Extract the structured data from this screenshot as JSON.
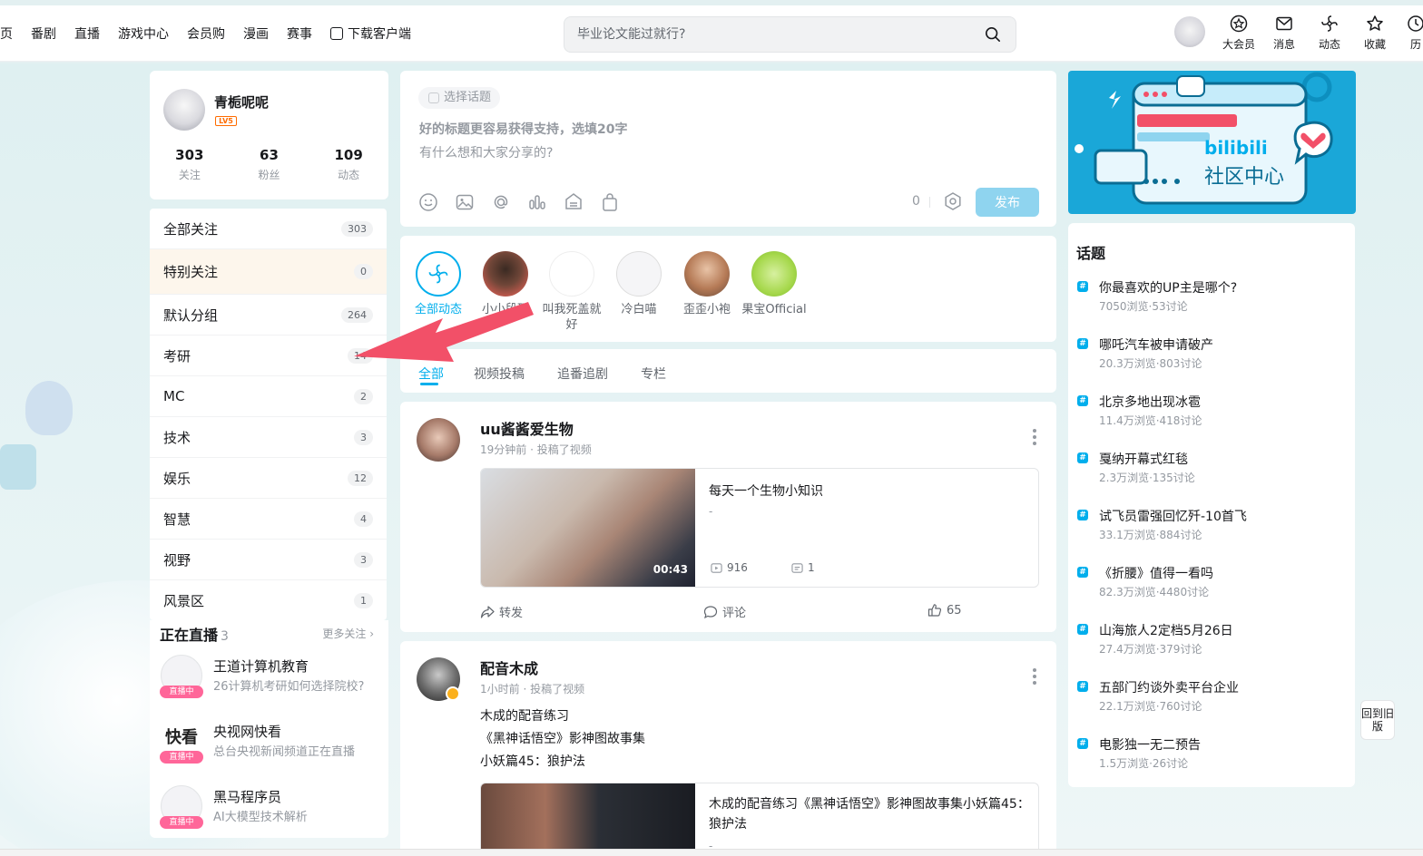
{
  "header": {
    "nav": [
      "首页",
      "番剧",
      "直播",
      "游戏中心",
      "会员购",
      "漫画",
      "赛事",
      "下载客户端"
    ],
    "search_placeholder": "毕业论文能过就行?",
    "icons": [
      {
        "label": "大会员",
        "icon": "vip-icon"
      },
      {
        "label": "消息",
        "icon": "message-icon"
      },
      {
        "label": "动态",
        "icon": "dynamic-icon"
      },
      {
        "label": "收藏",
        "icon": "favorite-icon"
      },
      {
        "label": "历",
        "icon": "history-icon"
      }
    ]
  },
  "profile": {
    "name": "青栀呢呢",
    "level": "LV5",
    "stats": [
      {
        "value": "303",
        "label": "关注"
      },
      {
        "value": "63",
        "label": "粉丝"
      },
      {
        "value": "109",
        "label": "动态"
      }
    ]
  },
  "groups": [
    {
      "name": "全部关注",
      "count": "303"
    },
    {
      "name": "特别关注",
      "count": "0"
    },
    {
      "name": "默认分组",
      "count": "264"
    },
    {
      "name": "考研",
      "count": "14"
    },
    {
      "name": "MC",
      "count": "2"
    },
    {
      "name": "技术",
      "count": "3"
    },
    {
      "name": "娱乐",
      "count": "12"
    },
    {
      "name": "智慧",
      "count": "4"
    },
    {
      "name": "视野",
      "count": "3"
    },
    {
      "name": "风景区",
      "count": "1"
    }
  ],
  "live": {
    "title": "正在直播",
    "count": "3",
    "more": "更多关注",
    "tag": "直播中",
    "items": [
      {
        "name": "王道计算机教育",
        "desc": "26计算机考研如何选择院校?"
      },
      {
        "name": "央视网快看",
        "desc": "总台央视新闻频道正在直播",
        "logo": "快看"
      },
      {
        "name": "黑马程序员",
        "desc": "AI大模型技术解析"
      }
    ]
  },
  "compose": {
    "topic": "选择话题",
    "title_placeholder": "好的标题更容易获得支持，选填20字",
    "body_placeholder": "有什么想和大家分享的?",
    "count": "0",
    "publish": "发布"
  },
  "following": [
    {
      "name": "全部动态"
    },
    {
      "name": "小小段砸"
    },
    {
      "name": "叫我死盖就好"
    },
    {
      "name": "冷白喵"
    },
    {
      "name": "歪歪小袍"
    },
    {
      "name": "果宝Official"
    }
  ],
  "tabs": [
    "全部",
    "视频投稿",
    "追番追剧",
    "专栏"
  ],
  "posts": [
    {
      "author": "uu酱酱爱生物",
      "time": "19分钟前 · 投稿了视频",
      "video_title": "每天一个生物小知识",
      "video_desc": "-",
      "duration": "00:43",
      "plays": "916",
      "danmaku": "1",
      "actions": {
        "forward": "转发",
        "comment": "评论",
        "like": "65"
      }
    },
    {
      "author": "配音木成",
      "time": "1小时前 · 投稿了视频",
      "lines": [
        "木成的配音练习",
        "《黑神话悟空》影神图故事集",
        "小妖篇45：狼护法"
      ],
      "video_title": "木成的配音练习《黑神话悟空》影神图故事集小妖篇45：狼护法",
      "video_desc": "-"
    }
  ],
  "banner": {
    "brand": "bilibili",
    "title": "社区中心"
  },
  "topics": {
    "title": "话题",
    "items": [
      {
        "name": "你最喜欢的UP主是哪个?",
        "stats": "7050浏览·53讨论"
      },
      {
        "name": "哪吒汽车被申请破产",
        "stats": "20.3万浏览·803讨论"
      },
      {
        "name": "北京多地出现冰雹",
        "stats": "11.4万浏览·418讨论"
      },
      {
        "name": "戛纳开幕式红毯",
        "stats": "2.3万浏览·135讨论"
      },
      {
        "name": "试飞员雷强回忆歼-10首飞",
        "stats": "33.1万浏览·884讨论"
      },
      {
        "name": "《折腰》值得一看吗",
        "stats": "82.3万浏览·4480讨论"
      },
      {
        "name": "山海旅人2定档5月26日",
        "stats": "27.4万浏览·379讨论"
      },
      {
        "name": "五部门约谈外卖平台企业",
        "stats": "22.1万浏览·760讨论"
      },
      {
        "name": "电影独一无二预告",
        "stats": "1.5万浏览·26讨论"
      }
    ]
  },
  "old_version": "回到旧版",
  "colors": {
    "accent": "#00aeec",
    "pink": "#ff6699",
    "arrow": "#f25068"
  }
}
